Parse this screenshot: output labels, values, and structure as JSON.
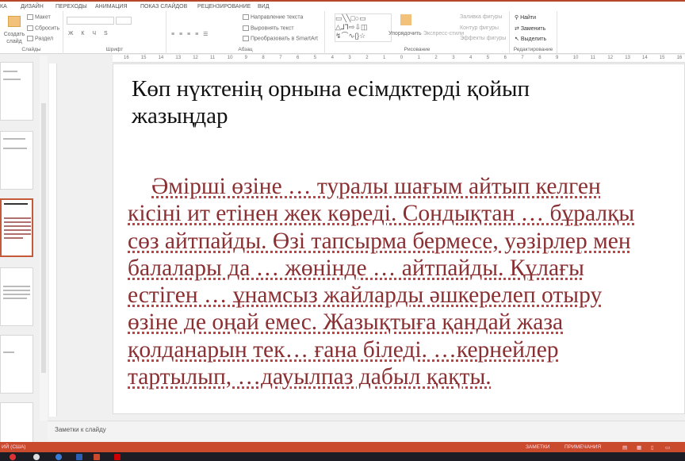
{
  "tabs": [
    "КА",
    "ДИЗАЙН",
    "ПЕРЕХОДЫ",
    "АНИМАЦИЯ",
    "ПОКАЗ СЛАЙДОВ",
    "РЕЦЕНЗИРОВАНИЕ",
    "ВИД"
  ],
  "ribbon": {
    "slides": {
      "new_slide": "Создать слайд",
      "layout": "Макет",
      "reset": "Сбросить",
      "section": "Раздел",
      "label": "Слайды"
    },
    "font": {
      "label": "Шрифт"
    },
    "paragraph": {
      "text_direction": "Направление текста",
      "align_text": "Выровнять текст",
      "smartart": "Преобразовать в SmartArt",
      "label": "Абзац"
    },
    "drawing": {
      "arrange": "Упорядочить",
      "quick_styles": "Экспресс-стили",
      "fill": "Заливка фигуры",
      "outline": "Контур фигуры",
      "effects": "Эффекты фигуры",
      "label": "Рисование"
    },
    "editing": {
      "find": "Найти",
      "replace": "Заменить",
      "select": "Выделить",
      "label": "Редактирование"
    }
  },
  "ruler": [
    "16",
    "15",
    "14",
    "13",
    "12",
    "11",
    "10",
    "9",
    "8",
    "7",
    "6",
    "5",
    "4",
    "3",
    "2",
    "1",
    "0",
    "1",
    "2",
    "3",
    "4",
    "5",
    "6",
    "7",
    "8",
    "9",
    "10",
    "11",
    "12",
    "13",
    "14",
    "15",
    "16"
  ],
  "slide": {
    "title": "Көп нүктенің орнына есімдіктерді қойып жазыңдар",
    "title_lines": [
      "Көп нүктенің орнына есімдктерді қойып",
      "жазыңдар"
    ],
    "body_lines": [
      "    Әмірші өзіне … туралы шағым айтып келген",
      "кісіні ит етінен жек көреді. Сондықтан … бұралқы",
      "сөз айтпайды. Өзі тапсырма бермесе, уәзірлер мен",
      "балалары да … жөнінде … айтпайды. Құлағы",
      "естіген … ұнамсыз жайларды әшкерелеп отыру",
      "өзіне де оңай емес. Жазықтыға қандай жаза",
      "қолданарын тек… ғана біледі. …кернейлер",
      "тартылып, …дауылпаз дабыл қақты."
    ],
    "text_color": "#8a2f32"
  },
  "notes_placeholder": "Заметки к слайду",
  "status": {
    "language": "ИЙ (США)",
    "notes": "ЗАМЕТКИ",
    "comments": "ПРИМЕЧАНИЯ"
  },
  "colors": {
    "accent": "#c94a2c"
  }
}
